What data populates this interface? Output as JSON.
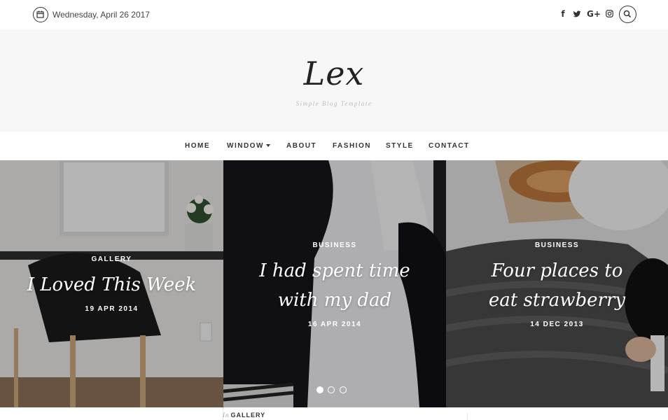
{
  "topbar": {
    "date": "Wednesday, April 26 2017",
    "social": [
      {
        "icon": "facebook-icon",
        "glyph": "f"
      },
      {
        "icon": "twitter-icon",
        "glyph": "t"
      },
      {
        "icon": "google-plus-icon",
        "glyph": "G+"
      },
      {
        "icon": "instagram-icon",
        "glyph": "◎"
      }
    ],
    "search_icon": "search-icon"
  },
  "header": {
    "logo": "Lex",
    "tagline": "Simple Blog Template"
  },
  "nav": {
    "items": [
      "HOME",
      "WINDOW",
      "ABOUT",
      "FASHION",
      "STYLE",
      "CONTACT"
    ]
  },
  "slides": [
    {
      "category": "GALLERY",
      "title": "I Loved This Week",
      "date": "19 APR 2014"
    },
    {
      "category": "BUSINESS",
      "title": "I had spent time with my dad",
      "date": "16 APR 2014"
    },
    {
      "category": "BUSINESS",
      "title": "Four places to eat strawberry",
      "date": "14 DEC 2013"
    }
  ],
  "slider_dots": {
    "count": 3,
    "active_index": 0
  },
  "bottom": {
    "in_label": "In",
    "category": "GALLERY"
  },
  "colors": {
    "header_bg": "#f7f7f7",
    "text": "#333333",
    "tagline": "#bbbbbb"
  }
}
